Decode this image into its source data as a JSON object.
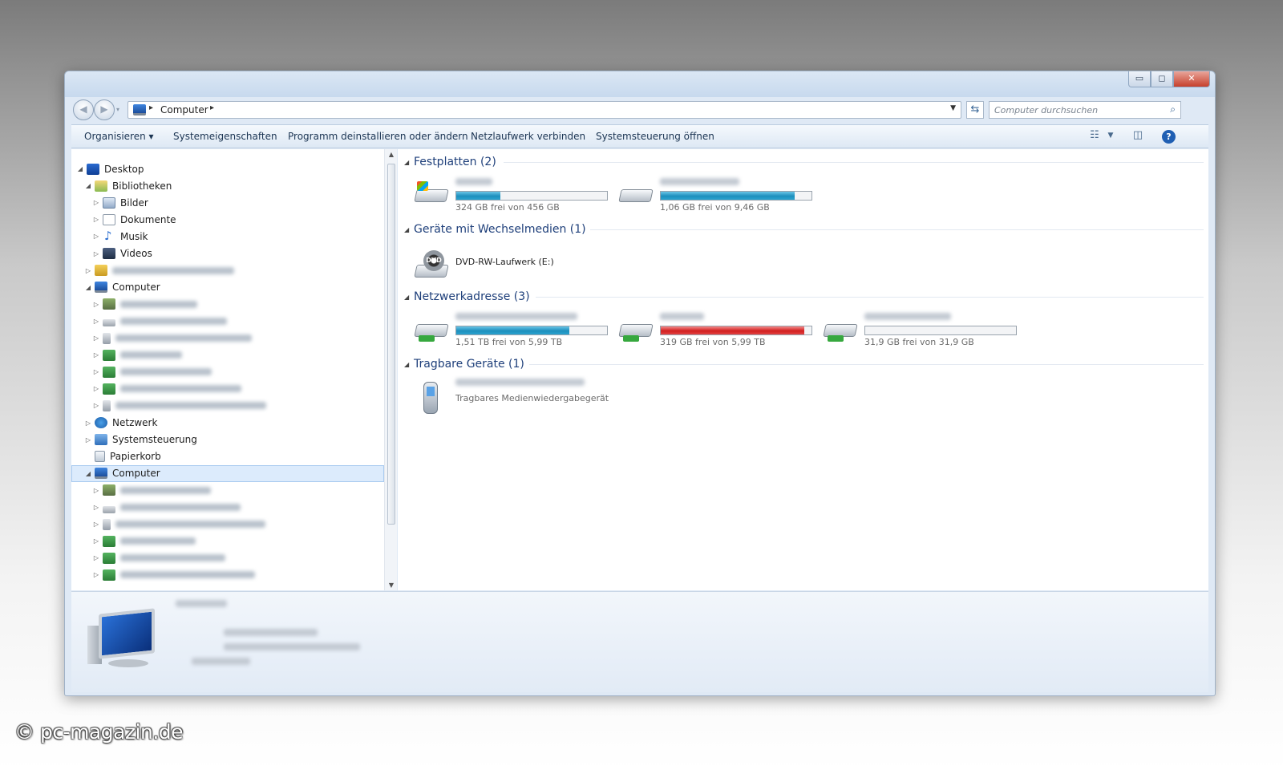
{
  "window": {
    "controls": {
      "minimize": "▭",
      "maximize": "◻",
      "close": "✕"
    }
  },
  "address_bar": {
    "path": [
      "Computer"
    ],
    "search_placeholder": "Computer durchsuchen"
  },
  "toolbar": {
    "organize": "Organisieren ▾",
    "system_properties": "Systemeigenschaften",
    "uninstall": "Programm deinstallieren oder ändern",
    "map_drive": "Netzlaufwerk verbinden",
    "control_panel": "Systemsteuerung öffnen"
  },
  "nav_tree": [
    {
      "label": "Desktop",
      "icon": "desktop-icon",
      "expanded": true
    },
    {
      "label": "Bibliotheken",
      "icon": "library-icon",
      "expanded": true
    },
    {
      "label": "Bilder",
      "icon": "pictures-icon"
    },
    {
      "label": "Dokumente",
      "icon": "documents-icon"
    },
    {
      "label": "Musik",
      "icon": "music-icon"
    },
    {
      "label": "Videos",
      "icon": "videos-icon"
    },
    {
      "label": "",
      "icon": "user-folder-icon",
      "blurred": true
    },
    {
      "label": "Computer",
      "icon": "computer-icon",
      "expanded": true
    },
    {
      "label": "",
      "icon": "user-drive-icon",
      "blurred": true
    },
    {
      "label": "",
      "icon": "drive-icon",
      "blurred": true
    },
    {
      "label": "",
      "icon": "removable-icon",
      "blurred": true
    },
    {
      "label": "",
      "icon": "network-drive-icon",
      "blurred": true
    },
    {
      "label": "",
      "icon": "network-drive-icon",
      "blurred": true
    },
    {
      "label": "",
      "icon": "network-drive-icon",
      "blurred": true
    },
    {
      "label": "",
      "icon": "portable-device-icon",
      "blurred": true
    },
    {
      "label": "Netzwerk",
      "icon": "network-icon"
    },
    {
      "label": "Systemsteuerung",
      "icon": "control-panel-icon"
    },
    {
      "label": "Papierkorb",
      "icon": "recycle-bin-icon"
    },
    {
      "label": "Computer",
      "icon": "computer-icon",
      "expanded": true,
      "selected": true
    },
    {
      "label": "",
      "icon": "user-drive-icon",
      "blurred": true
    },
    {
      "label": "",
      "icon": "drive-icon",
      "blurred": true
    },
    {
      "label": "",
      "icon": "removable-icon",
      "blurred": true
    },
    {
      "label": "",
      "icon": "network-drive-icon",
      "blurred": true
    },
    {
      "label": "",
      "icon": "network-drive-icon",
      "blurred": true
    },
    {
      "label": "",
      "icon": "network-drive-icon",
      "blurred": true
    }
  ],
  "groups": {
    "hard_disks": {
      "title": "Festplatten (2)",
      "items": [
        {
          "name": "",
          "sub": "324 GB frei von 456 GB",
          "used_fraction": 0.29,
          "color": "#1d8fbd"
        },
        {
          "name": "",
          "sub": "1,06 GB frei von 9,46 GB",
          "used_fraction": 0.89,
          "color": "#1d8fbd"
        }
      ]
    },
    "removable": {
      "title": "Geräte mit Wechselmedien (1)",
      "items": [
        {
          "name": "DVD-RW-Laufwerk (E:)",
          "icon_label": "DVD"
        }
      ]
    },
    "network": {
      "title": "Netzwerkadresse (3)",
      "items": [
        {
          "name": "",
          "sub": "1,51 TB frei von 5,99 TB",
          "used_fraction": 0.75,
          "color": "#1d8fbd"
        },
        {
          "name": "",
          "sub": "319 GB frei von 5,99 TB",
          "used_fraction": 0.95,
          "color": "#d21f1f"
        },
        {
          "name": "",
          "sub": "31,9 GB frei von 31,9 GB",
          "used_fraction": 0.0,
          "color": "#1d8fbd"
        }
      ]
    },
    "portable": {
      "title": "Tragbare Geräte (1)",
      "items": [
        {
          "name": "",
          "sub": "Tragbares Medienwiedergabegerät"
        }
      ]
    }
  },
  "details_pane": {
    "name": "",
    "rows": [
      "",
      "",
      ""
    ]
  },
  "watermark": "© pc-magazin.de"
}
